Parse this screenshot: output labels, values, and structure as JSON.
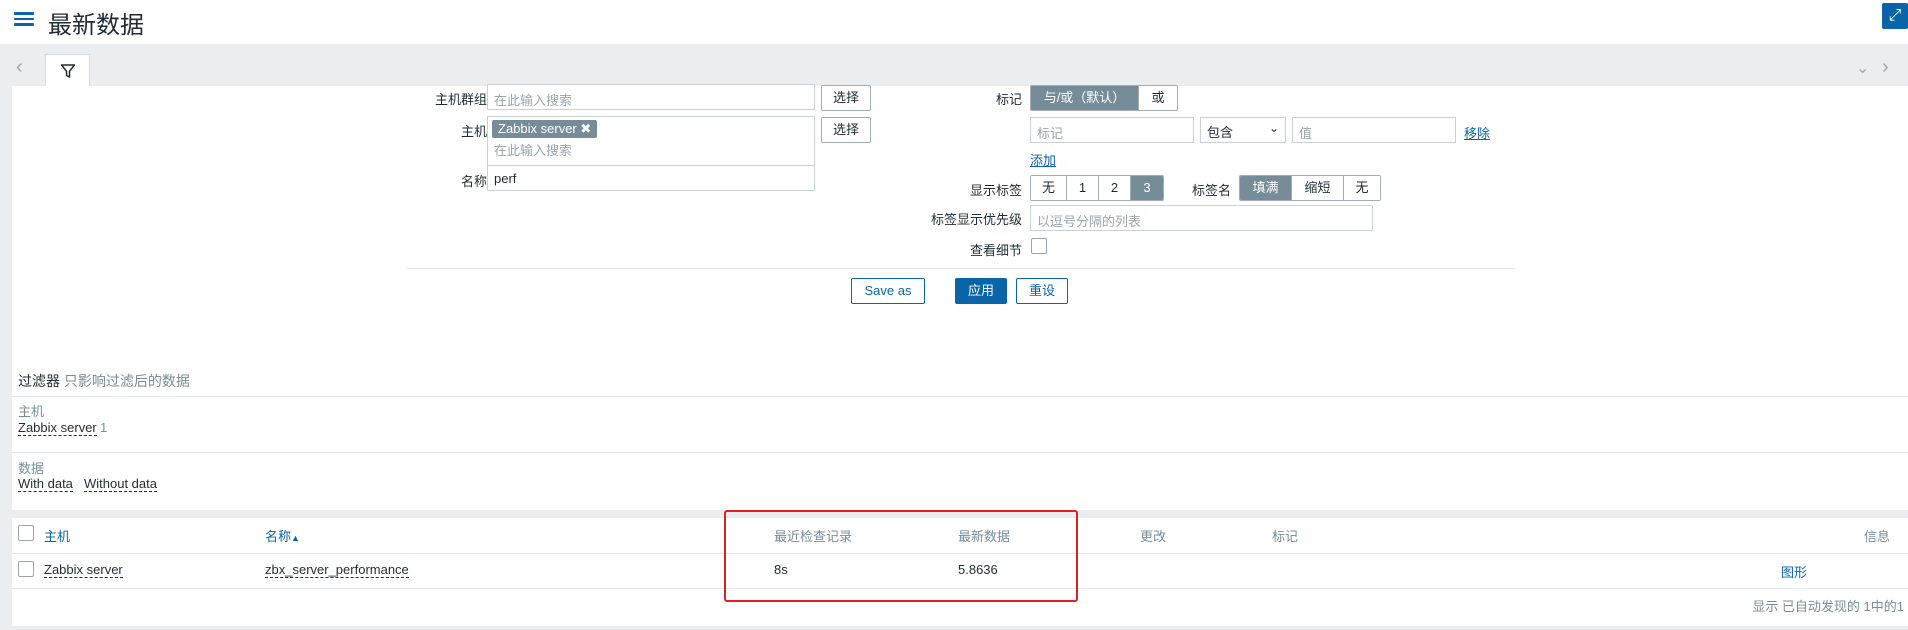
{
  "header": {
    "title": "最新数据"
  },
  "filter": {
    "host_groups_label": "主机群组",
    "host_groups_placeholder": "在此输入搜索",
    "select_label": "选择",
    "hosts_label": "主机",
    "host_chip": "Zabbix server",
    "hosts_placeholder": "在此输入搜索",
    "name_label": "名称",
    "name_value": "perf",
    "tags_label": "标记",
    "tag_mode_options": [
      "与/或（默认）",
      "或"
    ],
    "tag_placeholder": "标记",
    "tag_operator": "包含",
    "value_placeholder": "值",
    "remove_label": "移除",
    "add_label": "添加",
    "show_tags_label": "显示标签",
    "show_tags_options": [
      "无",
      "1",
      "2",
      "3"
    ],
    "tag_name_label": "标签名",
    "tag_name_options": [
      "填满",
      "缩短",
      "无"
    ],
    "tag_priority_label": "标签显示优先级",
    "tag_priority_placeholder": "以逗号分隔的列表",
    "show_details_label": "查看细节",
    "save_as_label": "Save as",
    "apply_label": "应用",
    "reset_label": "重设"
  },
  "subfilter": {
    "title": "过滤器",
    "subtitle": "只影响过滤后的数据",
    "hosts_group_label": "主机",
    "host_item": "Zabbix server",
    "host_item_count": "1",
    "data_group_label": "数据",
    "data_items": [
      "With data",
      "Without data"
    ]
  },
  "table": {
    "headers": {
      "host": "主机",
      "name": "名称",
      "sort_indicator": "▲",
      "last_check": "最近检查记录",
      "last_value": "最新数据",
      "change": "更改",
      "tags": "标记",
      "info": "信息"
    },
    "rows": [
      {
        "host": "Zabbix server",
        "name": "zbx_server_performance",
        "last_check": "8s",
        "last_value": "5.8636",
        "graph": "图形"
      }
    ],
    "footer": "显示 已自动发现的 1中的1"
  },
  "colors": {
    "accent": "#0a64a8",
    "highlight": "#e02020",
    "chip": "#768d99"
  }
}
